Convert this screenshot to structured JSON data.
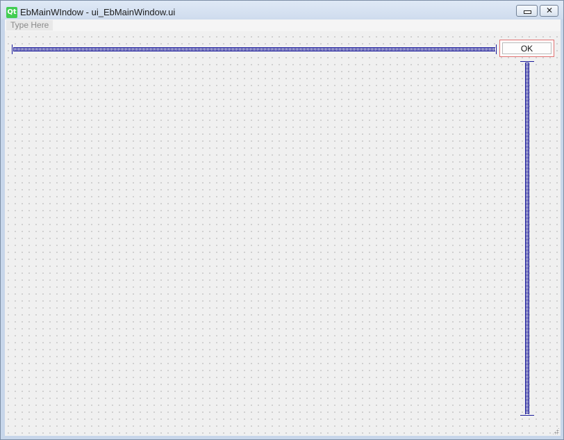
{
  "window": {
    "title": "EbMainWIndow - ui_EbMainWindow.ui",
    "logo_text": "Qt",
    "minimize_icon": "minimize-icon",
    "close_glyph": "✕"
  },
  "menubar": {
    "placeholder_item": "Type Here"
  },
  "form": {
    "ok_button_label": "OK"
  },
  "colors": {
    "spacer": "#1a1a9a",
    "qt_green": "#41cd52",
    "selection_border": "#e07070"
  }
}
